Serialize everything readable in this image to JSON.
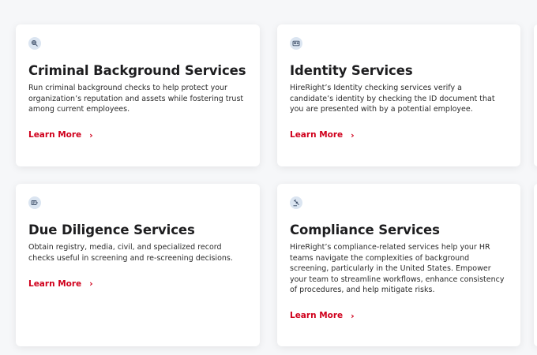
{
  "cards": [
    {
      "icon": "fingerprint-icon",
      "title": "Criminal Background Services",
      "description": "Run criminal background checks to help protect your organization’s reputation and assets while fostering trust among current employees.",
      "link_label": "Learn More"
    },
    {
      "icon": "id-card-icon",
      "title": "Identity Services",
      "description": "HireRight’s Identity checking services verify a candidate’s identity by checking the ID document that you are presented with by a potential employee.",
      "link_label": "Learn More"
    },
    {
      "icon": "document-search-icon",
      "title": "Due Diligence Services",
      "description": "Obtain registry, media, civil, and specialized record checks useful in screening and re-screening decisions.",
      "link_label": "Learn More"
    },
    {
      "icon": "gavel-icon",
      "title": "Compliance Services",
      "description": "HireRight’s compliance-related services help your HR teams navigate the complexities of background screening, particularly in the United States. Empower your team to streamline workflows, enhance consistency of procedures, and help mitigate risks.",
      "link_label": "Learn More"
    }
  ],
  "colors": {
    "accent": "#d0001c",
    "icon_bg": "#dbe5f1",
    "card_bg": "#ffffff",
    "page_bg": "#f6f7f9"
  },
  "chevron_glyph": "›"
}
